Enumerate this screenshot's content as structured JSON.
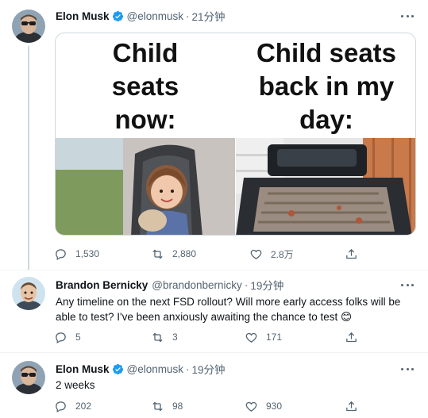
{
  "tweets": [
    {
      "name": "Elon Musk",
      "handle": "@elonmusk",
      "time": "21分钟",
      "media": {
        "left_caption": "Child seats now:",
        "right_caption": "Child seats back in my day:"
      },
      "stats": {
        "replies": "1,530",
        "retweets": "2,880",
        "likes": "2.8万"
      }
    },
    {
      "name": "Brandon Bernicky",
      "handle": "@brandonbernicky",
      "time": "19分钟",
      "text": "Any timeline on the next FSD rollout? Will more early access folks will be able to test? I've been anxiously awaiting the chance to test 😊",
      "stats": {
        "replies": "5",
        "retweets": "3",
        "likes": "171"
      }
    },
    {
      "name": "Elon Musk",
      "handle": "@elonmusk",
      "time": "19分钟",
      "text": "2 weeks",
      "stats": {
        "replies": "202",
        "retweets": "98",
        "likes": "930"
      }
    }
  ],
  "separator": "·",
  "colors": {
    "verified": "#1d9bf0",
    "secondary_text": "#536471",
    "thread_line": "#cfd9de"
  },
  "icons": [
    "verified-badge-icon",
    "more-icon",
    "reply-icon",
    "retweet-icon",
    "like-icon",
    "share-icon"
  ]
}
